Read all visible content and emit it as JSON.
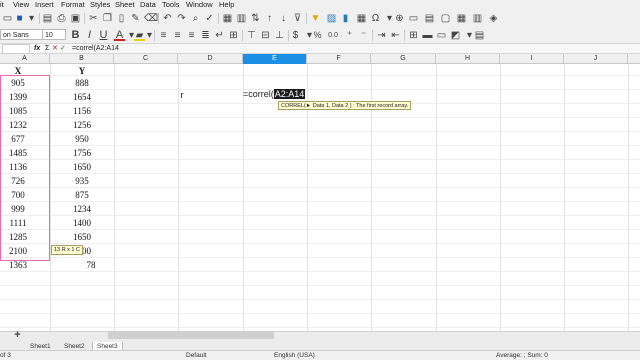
{
  "menu": [
    "it",
    "View",
    "Insert",
    "Format",
    "Styles",
    "Sheet",
    "Data",
    "Tools",
    "Window",
    "Help"
  ],
  "toolbar": {
    "font_name": "on Sans",
    "font_size": "10",
    "bold": "B",
    "italic": "I",
    "underline": "U",
    "font_color_label": "A",
    "percent": "%",
    "decimal": "0.0",
    "omega": "Ω"
  },
  "formula_bar": {
    "cell_ref": "",
    "fx": "fx",
    "sum": "Σ",
    "cancel": "✕",
    "accept": "✓",
    "content": "=correl(A2:A14"
  },
  "columns": [
    "A",
    "B",
    "C",
    "D",
    "E",
    "F",
    "G",
    "H",
    "I",
    "J"
  ],
  "selected_column": "E",
  "sheet": {
    "header_x": "X",
    "header_y": "Y",
    "x_values": [
      "905",
      "1399",
      "1085",
      "1232",
      "677",
      "1485",
      "1136",
      "726",
      "700",
      "999",
      "1111",
      "1285",
      "2100",
      "1363"
    ],
    "y_values": [
      "888",
      "1654",
      "1156",
      "1256",
      "950",
      "1756",
      "1650",
      "935",
      "875",
      "1234",
      "1400",
      "1650",
      "2300",
      "78"
    ],
    "d_label": "r",
    "edit_prefix": "=correl(",
    "edit_selected": "A2:A14"
  },
  "tooltip": "CORREL(► Data 1, Data 2 ) : The first record array.",
  "size_tip": "13 R x 1 C",
  "tabs": [
    "Sheet1",
    "Sheet2",
    "Sheet3"
  ],
  "active_tab": "Sheet3",
  "status": {
    "left": "of 3",
    "style": "Default",
    "language": "English (USA)",
    "summary": "Average: ; Sum: 0"
  },
  "colors": {
    "selected_column": "#1a8fe3",
    "range_border": "#e56bb4",
    "tooltip_bg": "#fffbd0"
  }
}
